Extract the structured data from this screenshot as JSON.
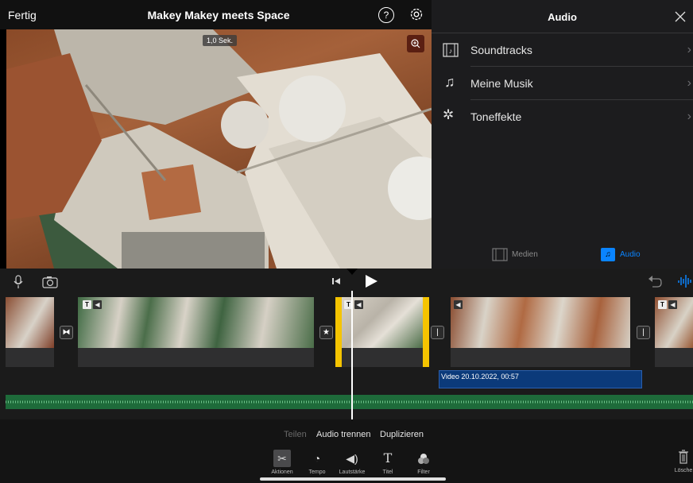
{
  "viewer": {
    "done_label": "Fertig",
    "project_title": "Makey Makey meets Space",
    "duration_badge": "1,0 Sek."
  },
  "audio_panel": {
    "title": "Audio",
    "items": [
      {
        "label": "Soundtracks",
        "icon": "film-music-icon"
      },
      {
        "label": "Meine Musik",
        "icon": "music-note-icon"
      },
      {
        "label": "Toneffekte",
        "icon": "sparkle-sound-icon"
      }
    ],
    "bottom_tabs": [
      {
        "label": "Medien",
        "active": false
      },
      {
        "label": "Audio",
        "active": true
      }
    ]
  },
  "timeline": {
    "audio_clip_label": "Video 20.10.2022, 00:57"
  },
  "toolbar": {
    "actions": [
      {
        "label": "Teilen",
        "enabled": false
      },
      {
        "label": "Audio trennen",
        "enabled": true
      },
      {
        "label": "Duplizieren",
        "enabled": true
      }
    ],
    "tools": [
      {
        "label": "Aktionen",
        "icon": "scissors-icon",
        "selected": true
      },
      {
        "label": "Tempo",
        "icon": "speedometer-icon",
        "selected": false
      },
      {
        "label": "Lautstärke",
        "icon": "speaker-icon",
        "selected": false
      },
      {
        "label": "Titel",
        "icon": "title-t-icon",
        "selected": false
      },
      {
        "label": "Filter",
        "icon": "filter-circles-icon",
        "selected": false
      }
    ],
    "delete_label": "Lösche"
  },
  "colors": {
    "accent_blue": "#0a84ff",
    "selection_yellow": "#f5c400",
    "audio_green": "#1e6b3a",
    "detached_audio_blue": "#0b3a7a"
  }
}
